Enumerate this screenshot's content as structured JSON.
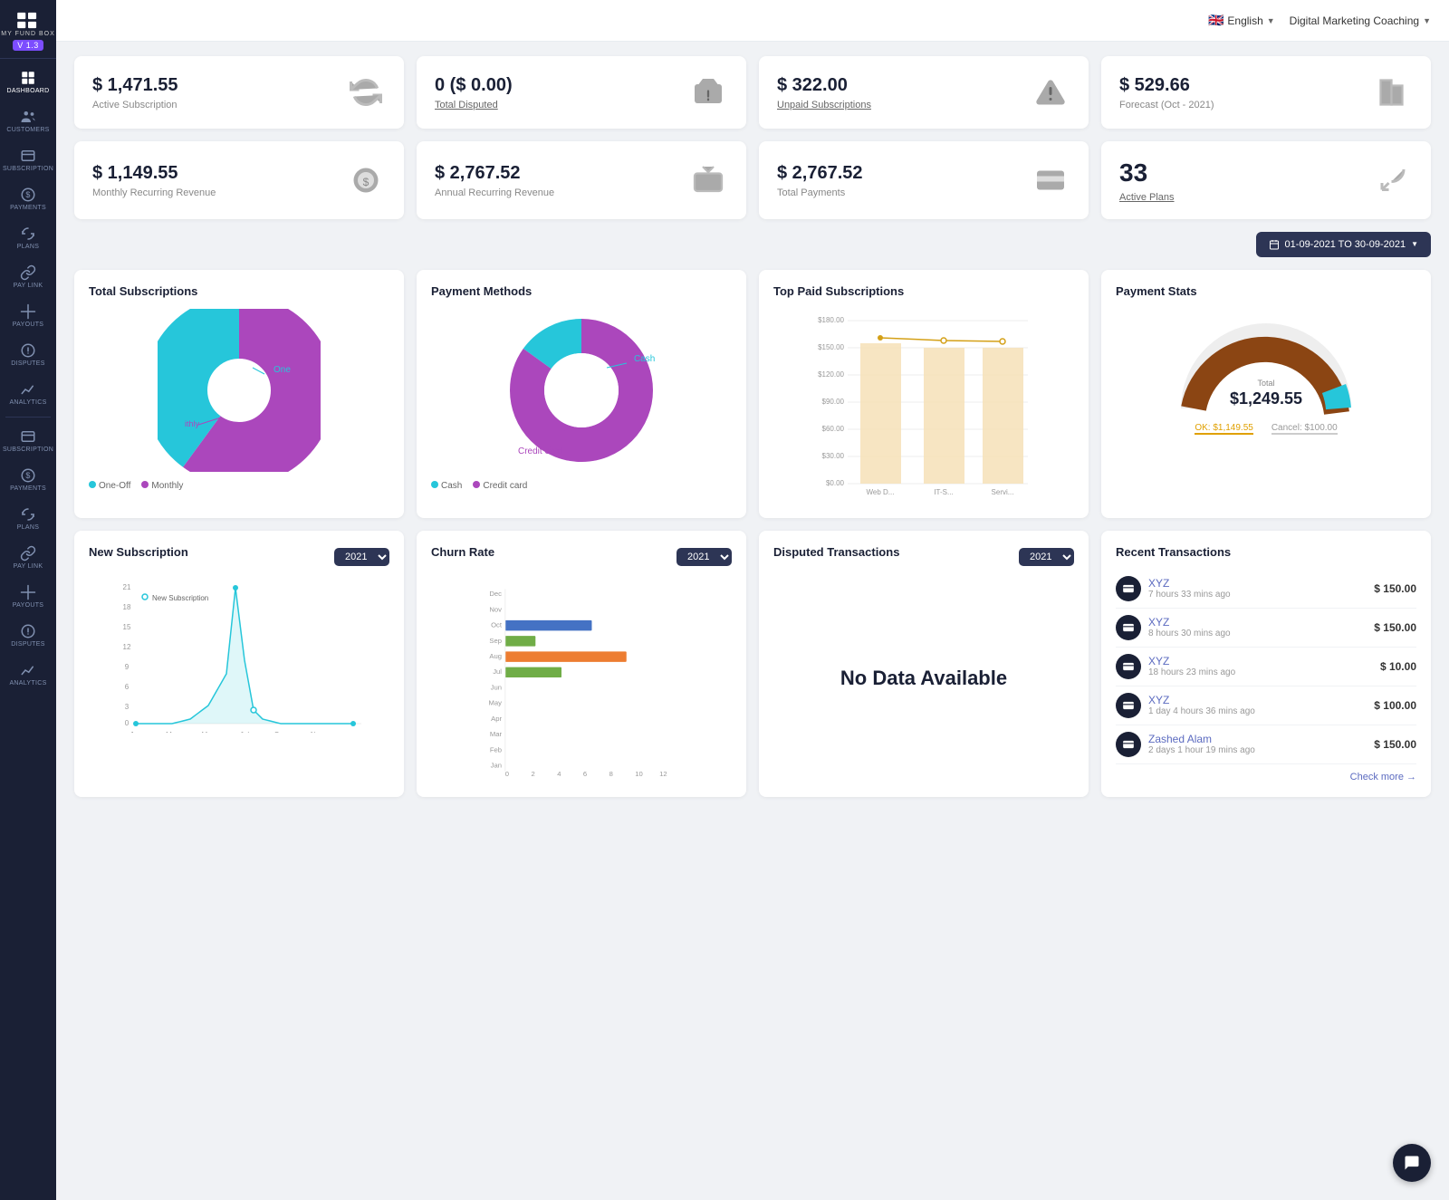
{
  "app": {
    "name": "MY FUND BOX",
    "version": "V 1.3"
  },
  "topbar": {
    "language": "English",
    "brand": "Digital Marketing Coaching"
  },
  "sidebar": {
    "items": [
      {
        "id": "dashboard",
        "label": "DASHBOARD",
        "icon": "grid"
      },
      {
        "id": "customers",
        "label": "CUSTOMERS",
        "icon": "people"
      },
      {
        "id": "subscription",
        "label": "SUBSCRIPTION",
        "icon": "card"
      },
      {
        "id": "payments",
        "label": "PAYMENTS",
        "icon": "dollar"
      },
      {
        "id": "plans",
        "label": "PLANS",
        "icon": "refresh"
      },
      {
        "id": "paylink",
        "label": "PAY LINK",
        "icon": "link"
      },
      {
        "id": "payouts",
        "label": "PAYOUTS",
        "icon": "payout"
      },
      {
        "id": "disputes",
        "label": "DISPUTES",
        "icon": "dispute"
      },
      {
        "id": "analytics",
        "label": "ANALYTICS",
        "icon": "chart"
      },
      {
        "id": "subscription2",
        "label": "SUBSCRIPTION",
        "icon": "card"
      },
      {
        "id": "payments2",
        "label": "PAYMENTS",
        "icon": "dollar"
      },
      {
        "id": "plans2",
        "label": "PLANS",
        "icon": "refresh"
      },
      {
        "id": "paylink2",
        "label": "PAY LINK",
        "icon": "link"
      },
      {
        "id": "payouts2",
        "label": "PAYOUTS",
        "icon": "payout"
      },
      {
        "id": "disputes2",
        "label": "DISPUTES",
        "icon": "dispute"
      },
      {
        "id": "analytics2",
        "label": "ANALYTICS",
        "icon": "chart"
      }
    ]
  },
  "stats": [
    {
      "id": "active-sub",
      "value": "$ 1,471.55",
      "label": "Active Subscription",
      "icon": "refresh"
    },
    {
      "id": "total-disputed",
      "value": "0 ($ 0.00)",
      "label": "Total Disputed",
      "icon": "money",
      "link": true
    },
    {
      "id": "unpaid-sub",
      "value": "$ 322.00",
      "label": "Unpaid Subscriptions",
      "icon": "warning",
      "link": true
    },
    {
      "id": "forecast",
      "value": "$ 529.66",
      "label": "Forecast (Oct - 2021)",
      "icon": "analytics"
    },
    {
      "id": "mrr",
      "value": "$ 1,149.55",
      "label": "Monthly Recurring Revenue",
      "icon": "coins"
    },
    {
      "id": "arr",
      "value": "$ 2,767.52",
      "label": "Annual Recurring Revenue",
      "icon": "tag"
    },
    {
      "id": "total-payments",
      "value": "$ 2,767.52",
      "label": "Total Payments",
      "icon": "credit"
    },
    {
      "id": "active-plans",
      "value": "33",
      "label": "Active Plans",
      "icon": "undo",
      "link": true
    }
  ],
  "date_range": {
    "label": "01-09-2021 TO 30-09-2021",
    "icon": "calendar"
  },
  "charts": {
    "total_subscriptions": {
      "title": "Total Subscriptions",
      "legend": [
        {
          "label": "One-Off",
          "color": "#26c6da"
        },
        {
          "label": "Monthly",
          "color": "#ab47bc"
        }
      ]
    },
    "payment_methods": {
      "title": "Payment Methods",
      "legend": [
        {
          "label": "Cash",
          "color": "#26c6da"
        },
        {
          "label": "Credit card",
          "color": "#ab47bc"
        }
      ],
      "cash_label": "Cash",
      "credit_label": "Credit card"
    },
    "top_paid": {
      "title": "Top Paid Subscriptions",
      "labels": [
        "Web D...",
        "IT-S...",
        "Servi..."
      ],
      "values": [
        155,
        150,
        150
      ],
      "y_labels": [
        "$0.00",
        "$30.00",
        "$60.00",
        "$90.00",
        "$120.00",
        "$150.00",
        "$180.00"
      ]
    },
    "payment_stats": {
      "title": "Payment Stats",
      "total_label": "Total",
      "total_value": "$1,249.55",
      "ok_label": "OK: $1,149.55",
      "cancel_label": "Cancel: $100.00"
    }
  },
  "bottom_charts": {
    "new_subscription": {
      "title": "New Subscription",
      "year": "2021",
      "line_label": "New Subscription",
      "x_labels": [
        "Jan",
        "Mar",
        "May",
        "Jul",
        "Sep",
        "Nov"
      ],
      "y_labels": [
        "0",
        "3",
        "6",
        "9",
        "12",
        "15",
        "18",
        "21"
      ]
    },
    "churn_rate": {
      "title": "Churn Rate",
      "year": "2021",
      "months": [
        "Jan",
        "Feb",
        "Mar",
        "Apr",
        "May",
        "Jun",
        "Jul",
        "Aug",
        "Sep",
        "Oct",
        "Nov",
        "Dec"
      ],
      "x_labels": [
        "0",
        "2",
        "4",
        "6",
        "8",
        "10",
        "12"
      ]
    },
    "disputed": {
      "title": "Disputed Transactions",
      "year": "2021",
      "no_data": "No Data Available"
    },
    "recent_transactions": {
      "title": "Recent Transactions",
      "transactions": [
        {
          "name": "XYZ",
          "time": "7 hours 33 mins ago",
          "amount": "$ 150.00"
        },
        {
          "name": "XYZ",
          "time": "8 hours 30 mins ago",
          "amount": "$ 150.00"
        },
        {
          "name": "XYZ",
          "time": "18 hours 23 mins ago",
          "amount": "$ 10.00"
        },
        {
          "name": "XYZ",
          "time": "1 day 4 hours 36 mins ago",
          "amount": "$ 100.00"
        },
        {
          "name": "Zashed Alam",
          "time": "2 days 1 hour 19 mins ago",
          "amount": "$ 150.00"
        }
      ],
      "check_more": "Check more →"
    }
  }
}
